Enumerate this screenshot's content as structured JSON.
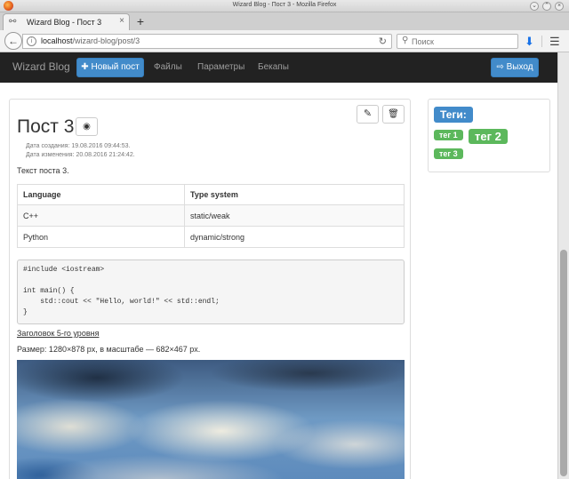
{
  "window": {
    "title": "Wizard Blog - Пост 3 - Mozilla Firefox"
  },
  "tab": {
    "title": "Wizard Blog - Пост 3"
  },
  "address": {
    "host": "localhost",
    "path": "/wizard-blog/post/3"
  },
  "search": {
    "placeholder": "Поиск"
  },
  "site_nav": {
    "brand": "Wizard Blog",
    "new_post": "Новый пост",
    "links": [
      "Файлы",
      "Параметры",
      "Бекапы"
    ],
    "logout": "Выход"
  },
  "post": {
    "title": "Пост 3",
    "created": "Дата создания: 19.08.2016 09:44:53.",
    "modified": "Дата изменения: 20.08.2016 21:24:42.",
    "text": "Текст поста 3.",
    "table": {
      "headers": [
        "Language",
        "Type system"
      ],
      "rows": [
        [
          "C++",
          "static/weak"
        ],
        [
          "Python",
          "dynamic/strong"
        ]
      ]
    },
    "code": "#include <iostream>\n\nint main() {\n    std::cout << \"Hello, world!\" << std::endl;\n}",
    "heading_link": "Заголовок 5-го уровня",
    "size_text": "Размер: 1280×878 px, в масштабе — 682×467 px."
  },
  "tags": {
    "label": "Теги:",
    "items": [
      "тег 1",
      "тег 2",
      "тег 3"
    ]
  },
  "colors": {
    "primary": "#428bca",
    "success": "#5cb85c",
    "navbar": "#222222"
  }
}
